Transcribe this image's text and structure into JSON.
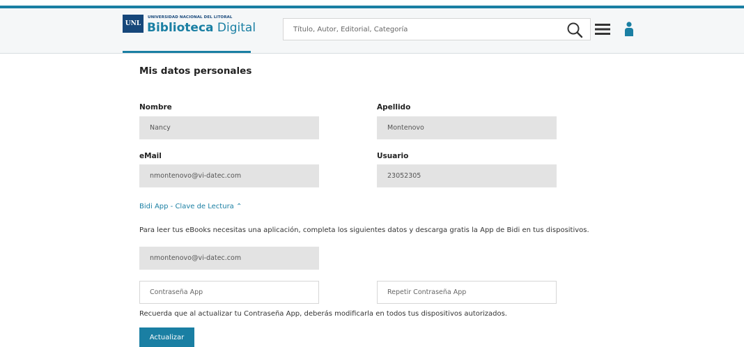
{
  "header": {
    "logo_small": "UNL",
    "logo_subtitle": "UNIVERSIDAD NACIONAL DEL LITORAL",
    "logo_title_bold": "Biblioteca",
    "logo_title_light": "Digital",
    "search_placeholder": "Título, Autor, Editorial, Categoría",
    "icons": [
      "search-icon",
      "menu-icon",
      "user-icon"
    ]
  },
  "page": {
    "title": "Mis datos personales",
    "fields": {
      "nombre": {
        "label": "Nombre",
        "value": "Nancy"
      },
      "apellido": {
        "label": "Apellido",
        "value": "Montenovo"
      },
      "email": {
        "label": "eMail",
        "value": "nmontenovo@vi-datec.com"
      },
      "usuario": {
        "label": "Usuario",
        "value": "23052305"
      }
    },
    "bidi_link": "Bidi App - Clave de Lectura ⌃",
    "bidi_info": "Para leer tus eBooks necesitas una aplicación, completa los siguientes datos y descarga gratis la App de Bidi en tus dispositivos.",
    "app_email": "nmontenovo@vi-datec.com",
    "password_placeholder": "Contraseña App",
    "repeat_password_placeholder": "Repetir Contraseña App",
    "reminder": "Recuerda que al actualizar tu Contraseña App, deberás modificarla en todos tus dispositivos autorizados.",
    "submit_label": "Actualizar"
  },
  "colors": {
    "accent": "#1a7fa3",
    "logo_navy": "#16477a",
    "field_bg": "#e3e3e3"
  }
}
